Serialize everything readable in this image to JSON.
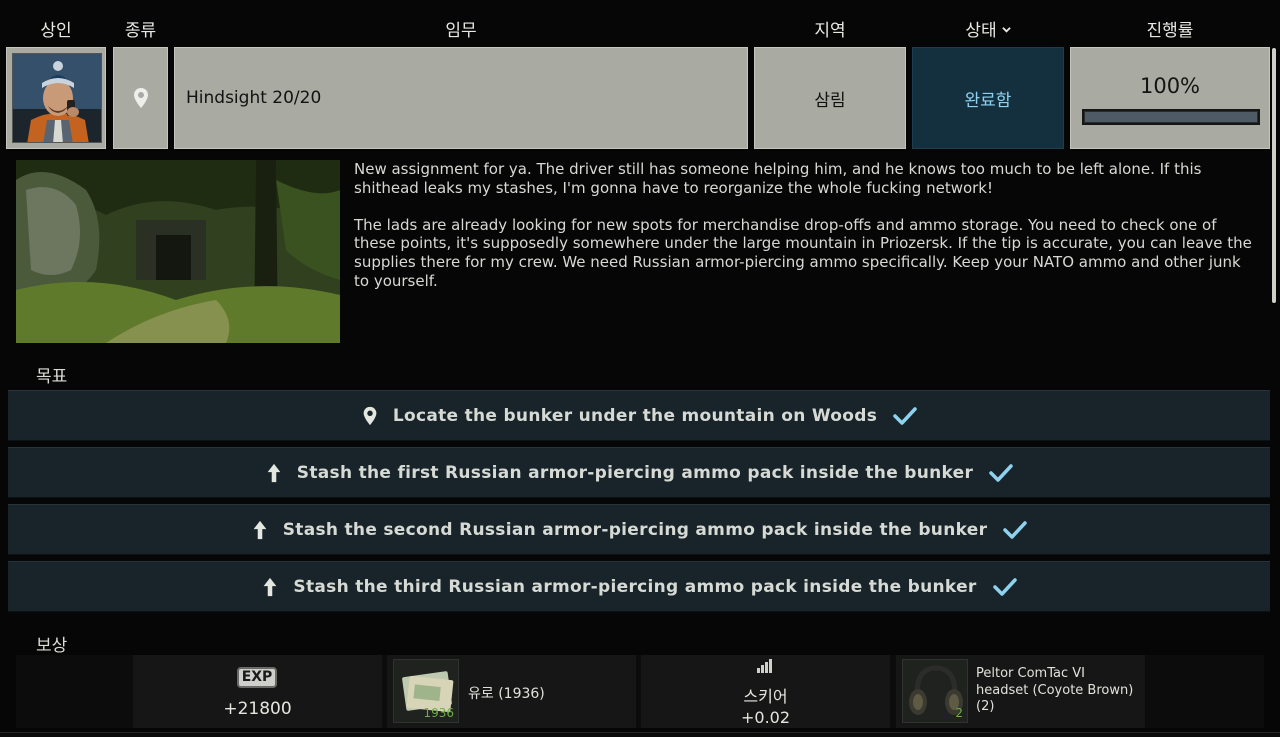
{
  "header": {
    "trader": "상인",
    "type": "종류",
    "task": "임무",
    "location": "지역",
    "status": "상태",
    "progress": "진행률"
  },
  "quest": {
    "type_icon": "map-pin-icon",
    "name": "Hindsight 20/20",
    "location": "삼림",
    "status": "완료함",
    "progress_text": "100%",
    "progress_value": 1.0
  },
  "description": {
    "paragraphs": [
      "New assignment for ya. The driver still has someone helping him, and he knows too much to be left alone. If this shithead leaks my stashes, I'm gonna have to reorganize the whole fucking network!",
      "The lads are already looking for new spots for merchandise drop-offs and ammo storage. You need to check one of these points, it's supposedly somewhere under the large mountain in Priozersk. If the tip is accurate, you can leave the supplies there for my crew. We need Russian armor-piercing ammo specifically. Keep your NATO ammo and other junk to yourself."
    ]
  },
  "objectives": {
    "label": "목표",
    "items": [
      {
        "icon": "map-pin-icon",
        "text": "Locate the bunker under the mountain on Woods",
        "done": true
      },
      {
        "icon": "stash-arrow-icon",
        "text": "Stash the first Russian armor-piercing ammo pack inside the bunker",
        "done": true
      },
      {
        "icon": "stash-arrow-icon",
        "text": "Stash the second Russian armor-piercing ammo pack inside the bunker",
        "done": true
      },
      {
        "icon": "stash-arrow-icon",
        "text": "Stash the third Russian armor-piercing ammo pack inside the bunker",
        "done": true
      }
    ]
  },
  "rewards": {
    "label": "보상",
    "exp": {
      "badge": "EXP",
      "value": "+21800"
    },
    "euros": {
      "label": "유로 (1936)",
      "count": "1936"
    },
    "skill": {
      "name": "스키어",
      "value": "+0.02"
    },
    "item": {
      "label": "Peltor ComTac VI headset (Coyote Brown) (2)",
      "count": "2"
    }
  },
  "colors": {
    "status_bg": "#14303f",
    "status_text": "#8fd2ef",
    "check": "#8fd2ef",
    "cell_bg": "#a9aba2"
  }
}
